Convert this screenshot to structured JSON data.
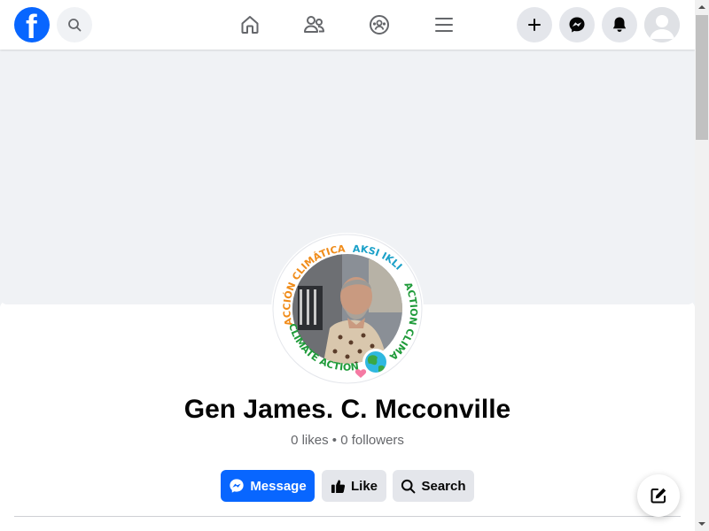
{
  "nav": {
    "logo_letter": "f",
    "icons": [
      "search-icon",
      "home-icon",
      "friends-icon",
      "groups-icon",
      "menu-icon",
      "plus-icon",
      "messenger-icon",
      "bell-icon",
      "avatar"
    ]
  },
  "profile": {
    "name": "Gen James. C. Mcconville",
    "likes": "0 likes",
    "separator": "•",
    "followers": "0 followers",
    "frame_text_top_left": "ACCIÓN CLIMÁTICA",
    "frame_text_top_right": "AKSI IKLIM",
    "frame_text_right": "ACTION CLIMAT",
    "frame_text_bottom": "CLIMATE ACTION"
  },
  "actions": {
    "message_label": "Message",
    "like_label": "Like",
    "search_label": "Search"
  },
  "colors": {
    "brand_blue": "#0866ff",
    "button_gray": "#e4e6eb",
    "frame_orange": "#f08c1a",
    "frame_teal": "#1aa0c8",
    "frame_green": "#1f9b3a"
  }
}
